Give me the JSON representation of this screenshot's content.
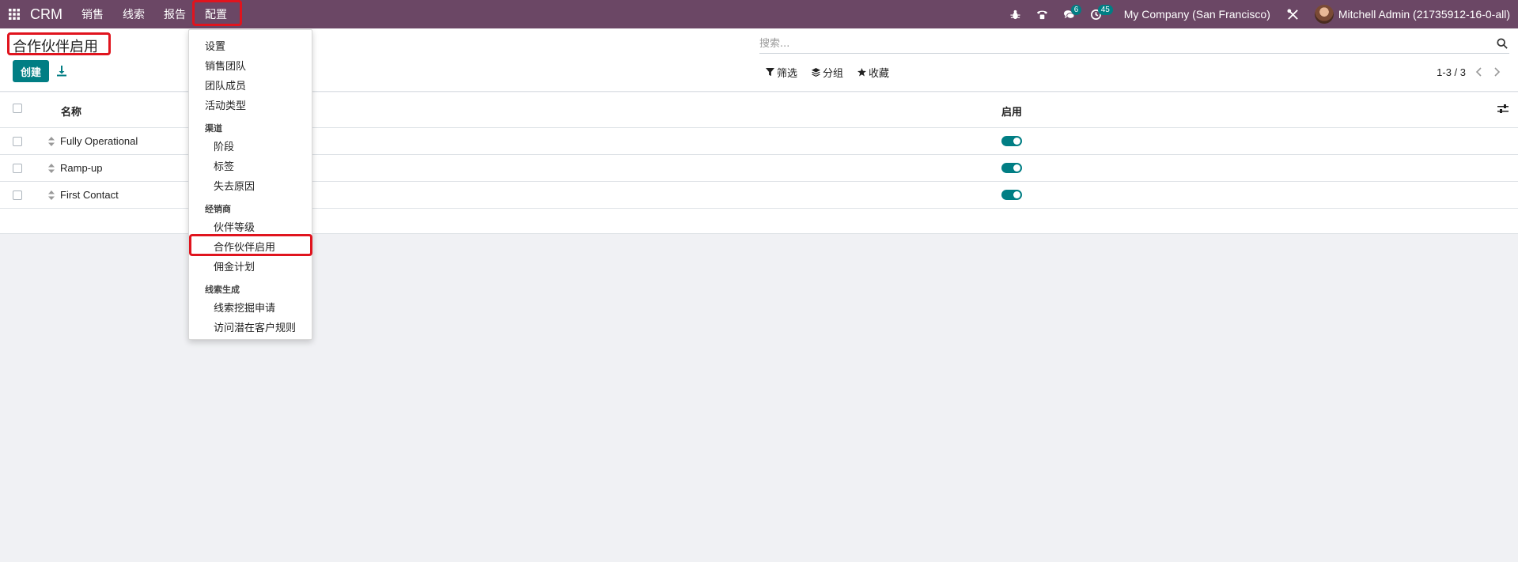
{
  "navbar": {
    "brand": "CRM",
    "menus": [
      "销售",
      "线索",
      "报告",
      "配置"
    ],
    "messages_count": "6",
    "activities_count": "45",
    "company": "My Company (San Francisco)",
    "user": "Mitchell Admin (21735912-16-0-all)"
  },
  "control": {
    "title": "合作伙伴启用",
    "create_label": "创建",
    "search_placeholder": "搜索...",
    "filter_label": "筛选",
    "groupby_label": "分组",
    "favorites_label": "收藏",
    "pager": "1-3 / 3"
  },
  "list": {
    "columns": [
      "名称",
      "启用"
    ],
    "rows": [
      {
        "name": "Fully Operational",
        "active": true
      },
      {
        "name": "Ramp-up",
        "active": true
      },
      {
        "name": "First Contact",
        "active": true
      }
    ]
  },
  "dropdown": {
    "items": [
      {
        "label": "设置"
      },
      {
        "label": "销售团队"
      },
      {
        "label": "团队成员"
      },
      {
        "label": "活动类型"
      }
    ],
    "section_pipeline": "渠道",
    "pipeline_items": [
      "阶段",
      "标签",
      "失去原因"
    ],
    "section_resellers": "经销商",
    "reseller_items": [
      "伙伴等级",
      "合作伙伴启用",
      "佣金计划"
    ],
    "section_leadgen": "线索生成",
    "leadgen_items": [
      "线索挖掘申请",
      "访问潜在客户规则"
    ]
  },
  "colors": {
    "navbar": "#6b4765",
    "primary": "#017e84",
    "highlight": "#e0141e"
  }
}
